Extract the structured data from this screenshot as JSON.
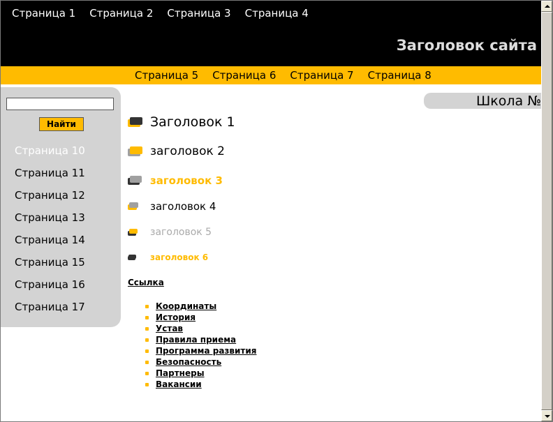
{
  "header": {
    "top_nav": [
      "Страница 1",
      "Страница 2",
      "Страница 3",
      "Страница 4"
    ],
    "site_title": "Заголовок сайта",
    "sub_nav": [
      "Страница 5",
      "Страница 6",
      "Страница 7",
      "Страница 8"
    ]
  },
  "sidebar": {
    "search_value": "",
    "search_button": "Найти",
    "items": [
      "Страница 10",
      "Страница 11",
      "Страница 12",
      "Страница 13",
      "Страница 14",
      "Страница 15",
      "Страница 16",
      "Страница 17"
    ],
    "active_item": "Страница 10"
  },
  "school_tab": "Школа №",
  "main": {
    "headings": [
      "Заголовок 1",
      "заголовок 2",
      "заголовок 3",
      "заголовок 4",
      "заголовок 5",
      "заголовок 6"
    ],
    "link": "Ссылка",
    "list": [
      "Координаты",
      "История",
      "Устав",
      "Правила приема",
      "Программа развития",
      "Безопасность",
      "Партнеры",
      "Вакансии"
    ]
  },
  "colors": {
    "accent": "#ffbb00",
    "header_bg": "#000000",
    "sidebar_bg": "#d3d3d3",
    "dark_gray": "#333333",
    "mid_gray": "#a0a0a0"
  },
  "icons": [
    "heading-marker-icon",
    "scroll-up-icon",
    "scroll-down-icon"
  ]
}
